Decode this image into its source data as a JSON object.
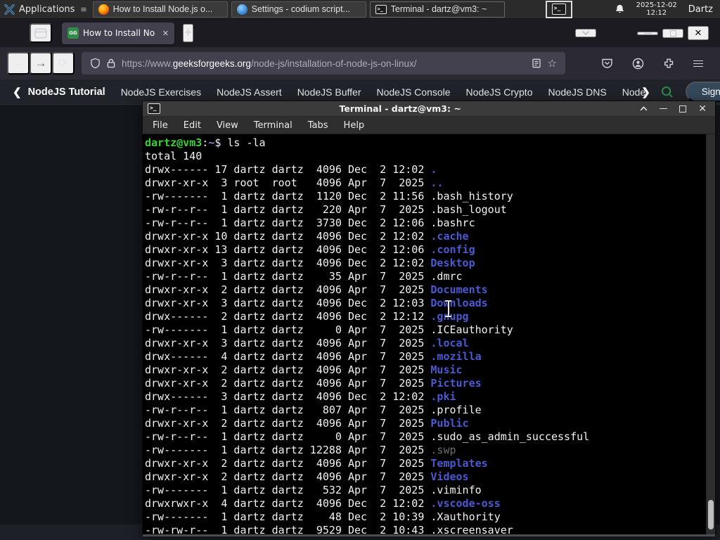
{
  "panel": {
    "applications": "Applications",
    "windows": [
      {
        "label": "How to Install Node.js o...",
        "icon": "firefox"
      },
      {
        "label": "Settings - codium script...",
        "icon": "codium"
      },
      {
        "label": "Terminal - dartz@vm3: ~",
        "icon": "terminal"
      }
    ],
    "clock": {
      "date": "2025-12-02",
      "time": "12:12"
    },
    "user": "Dartz"
  },
  "browser": {
    "tab": {
      "title": "How to Install Node.js on",
      "favicon": "geeksforgeeks-icon"
    },
    "urlbar": {
      "prefix": "https://www.",
      "domain": "geeksforgeeks.org",
      "path": "/node-js/installation-of-node-js-on-linux/"
    }
  },
  "site_nav": {
    "back": "NodeJS Tutorial",
    "items": [
      "NodeJS Exercises",
      "NodeJS Assert",
      "NodeJS Buffer",
      "NodeJS Console",
      "NodeJS Crypto",
      "NodeJS DNS",
      "Node"
    ],
    "next_chevron": "❯",
    "back_chevron": "❮",
    "sign_in": "Sign In",
    "accent_green": "#2f8d46"
  },
  "terminal": {
    "title": "Terminal - dartz@vm3: ~",
    "menu": [
      "File",
      "Edit",
      "View",
      "Terminal",
      "Tabs",
      "Help"
    ],
    "prompt": {
      "user_host": "dartz@vm3",
      "colon": ":",
      "path": "~",
      "dollar": "$ ",
      "command": "ls -la"
    },
    "total": "total 140",
    "colors": {
      "directory": "#4a5ad0",
      "file": "#f2f2f2",
      "dim_file": "#6f6f6f",
      "prompt_green": "#38d338"
    },
    "listing": [
      {
        "meta": "drwx------ 17 dartz dartz  4096 Dec  2 12:02 ",
        "name": ".",
        "type": "dir"
      },
      {
        "meta": "drwxr-xr-x  3 root  root   4096 Apr  7  2025 ",
        "name": "..",
        "type": "dir"
      },
      {
        "meta": "-rw-------  1 dartz dartz  1120 Dec  2 11:56 ",
        "name": ".bash_history",
        "type": "file"
      },
      {
        "meta": "-rw-r--r--  1 dartz dartz   220 Apr  7  2025 ",
        "name": ".bash_logout",
        "type": "file"
      },
      {
        "meta": "-rw-r--r--  1 dartz dartz  3730 Dec  2 12:06 ",
        "name": ".bashrc",
        "type": "file"
      },
      {
        "meta": "drwxr-xr-x 10 dartz dartz  4096 Dec  2 12:02 ",
        "name": ".cache",
        "type": "dir"
      },
      {
        "meta": "drwxr-xr-x 13 dartz dartz  4096 Dec  2 12:06 ",
        "name": ".config",
        "type": "dir"
      },
      {
        "meta": "drwxr-xr-x  3 dartz dartz  4096 Dec  2 12:02 ",
        "name": "Desktop",
        "type": "dir"
      },
      {
        "meta": "-rw-r--r--  1 dartz dartz    35 Apr  7  2025 ",
        "name": ".dmrc",
        "type": "file"
      },
      {
        "meta": "drwxr-xr-x  2 dartz dartz  4096 Apr  7  2025 ",
        "name": "Documents",
        "type": "dir"
      },
      {
        "meta": "drwxr-xr-x  3 dartz dartz  4096 Dec  2 12:03 ",
        "name": "Downloads",
        "type": "dir"
      },
      {
        "meta": "drwx------  2 dartz dartz  4096 Dec  2 12:12 ",
        "name": ".gnupg",
        "type": "dir"
      },
      {
        "meta": "-rw-------  1 dartz dartz     0 Apr  7  2025 ",
        "name": ".ICEauthority",
        "type": "file"
      },
      {
        "meta": "drwxr-xr-x  3 dartz dartz  4096 Apr  7  2025 ",
        "name": ".local",
        "type": "dir"
      },
      {
        "meta": "drwx------  4 dartz dartz  4096 Apr  7  2025 ",
        "name": ".mozilla",
        "type": "dir"
      },
      {
        "meta": "drwxr-xr-x  2 dartz dartz  4096 Apr  7  2025 ",
        "name": "Music",
        "type": "dir"
      },
      {
        "meta": "drwxr-xr-x  2 dartz dartz  4096 Apr  7  2025 ",
        "name": "Pictures",
        "type": "dir"
      },
      {
        "meta": "drwx------  3 dartz dartz  4096 Dec  2 12:02 ",
        "name": ".pki",
        "type": "dir"
      },
      {
        "meta": "-rw-r--r--  1 dartz dartz   807 Apr  7  2025 ",
        "name": ".profile",
        "type": "file"
      },
      {
        "meta": "drwxr-xr-x  2 dartz dartz  4096 Apr  7  2025 ",
        "name": "Public",
        "type": "dir"
      },
      {
        "meta": "-rw-r--r--  1 dartz dartz     0 Apr  7  2025 ",
        "name": ".sudo_as_admin_successful",
        "type": "file"
      },
      {
        "meta": "-rw-------  1 dartz dartz 12288 Apr  7  2025 ",
        "name": ".swp",
        "type": "dim"
      },
      {
        "meta": "drwxr-xr-x  2 dartz dartz  4096 Apr  7  2025 ",
        "name": "Templates",
        "type": "dir"
      },
      {
        "meta": "drwxr-xr-x  2 dartz dartz  4096 Apr  7  2025 ",
        "name": "Videos",
        "type": "dir"
      },
      {
        "meta": "-rw-------  1 dartz dartz   532 Apr  7  2025 ",
        "name": ".viminfo",
        "type": "file"
      },
      {
        "meta": "drwxrwxr-x  4 dartz dartz  4096 Dec  2 12:02 ",
        "name": ".vscode-oss",
        "type": "dir"
      },
      {
        "meta": "-rw-------  1 dartz dartz    48 Dec  2 10:39 ",
        "name": ".Xauthority",
        "type": "file"
      },
      {
        "meta": "-rw-rw-r--  1 dartz dartz  9529 Dec  2 10:43 ",
        "name": ".xscreensaver",
        "type": "file"
      }
    ]
  }
}
